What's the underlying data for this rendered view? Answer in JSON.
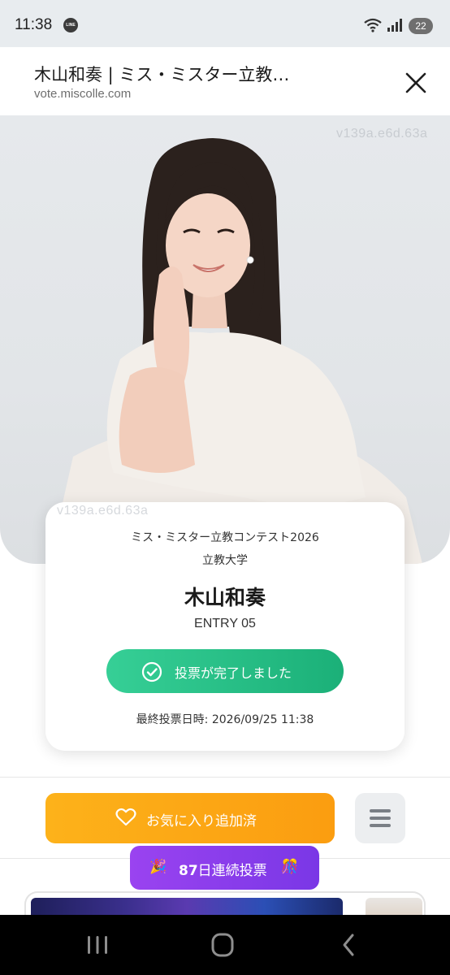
{
  "status_bar": {
    "time": "11:38",
    "app_icon_text": "LINE",
    "battery": "22"
  },
  "browser": {
    "title": "木山和奏 | ミス・ミスター立教…",
    "url": "vote.miscolle.com"
  },
  "hero": {
    "watermark": "v139a.e6d.63a"
  },
  "profile": {
    "watermark": "v139a.e6d.63a",
    "contest": "ミス・ミスター立教コンテスト2026",
    "university": "立教大学",
    "name": "木山和奏",
    "entry": "ENTRY 05",
    "vote_status": "投票が完了しました",
    "last_vote": "最終投票日時: 2026/09/25 11:38"
  },
  "actions": {
    "favorite_label": "お気に入り追加済"
  },
  "streak": {
    "emoji_left": "🎉",
    "days": "87",
    "label_suffix": "日連続投票",
    "emoji_right": "🎊"
  },
  "colors": {
    "vote_green": "#22bd82",
    "favorite_orange": "#fca716",
    "streak_purple": "#8a3eeb"
  }
}
